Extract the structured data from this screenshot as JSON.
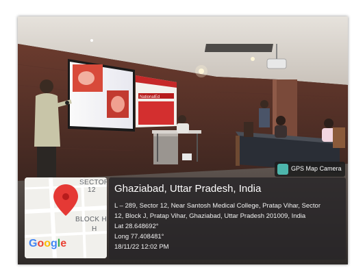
{
  "gps_overlay": {
    "badge_label": "GPS Map Camera",
    "location_title": "Ghaziabad, Uttar Pradesh, India",
    "address_line1": "L – 289, Sector 12, Near Santosh Medical College, Pratap Vihar, Sector",
    "address_line2": "12, Block J, Pratap Vihar, Ghaziabad, Uttar Pradesh 201009, India",
    "latitude": "Lat 28.648692°",
    "longitude": "Long 77.408481°",
    "datetime": "18/11/22 12:02 PM"
  },
  "map_tile": {
    "labels": [
      "SECTOR",
      "12",
      "BLOCK H",
      "H"
    ],
    "logo_text": "Google",
    "pin_color": "#e53935"
  },
  "banner": {
    "brand_text": "NationalEd"
  }
}
